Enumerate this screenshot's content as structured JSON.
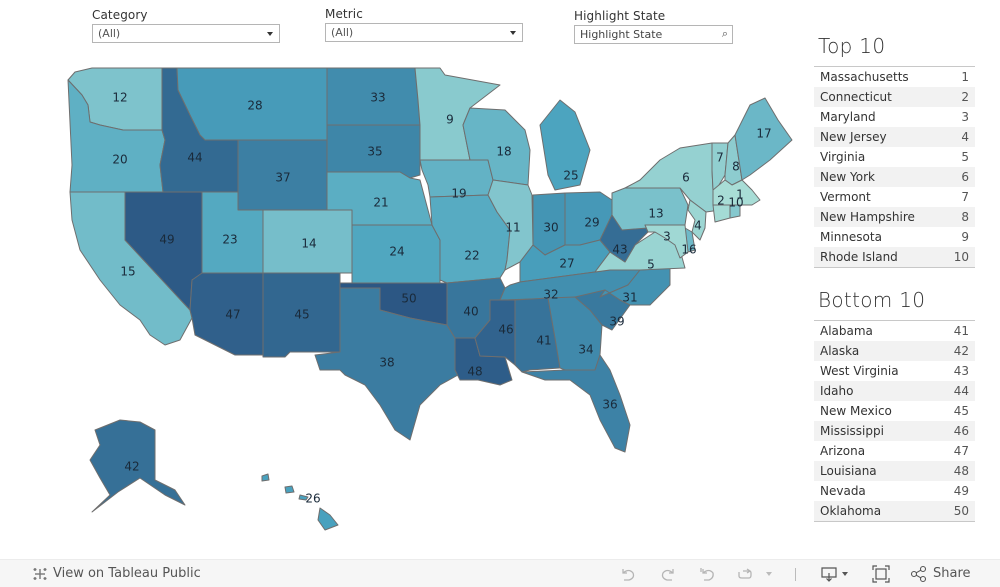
{
  "filters": {
    "category": {
      "label": "Category",
      "value": "(All)"
    },
    "metric": {
      "label": "Metric",
      "value": "(All)"
    },
    "highlight": {
      "label": "Highlight State",
      "placeholder": "Highlight State"
    }
  },
  "colors": {
    "rank_low": "#a8ddd6",
    "rank_mid": "#4aa3bf",
    "rank_high": "#2c5784",
    "state_border": "#6e6e6e",
    "toolbar_bg": "#f6f6f6"
  },
  "map": {
    "states": [
      {
        "abbr": "WA",
        "name": "Washington",
        "rank": 12
      },
      {
        "abbr": "OR",
        "name": "Oregon",
        "rank": 20
      },
      {
        "abbr": "CA",
        "name": "California",
        "rank": 15
      },
      {
        "abbr": "ID",
        "name": "Idaho",
        "rank": 44
      },
      {
        "abbr": "NV",
        "name": "Nevada",
        "rank": 49
      },
      {
        "abbr": "MT",
        "name": "Montana",
        "rank": 28
      },
      {
        "abbr": "WY",
        "name": "Wyoming",
        "rank": 37
      },
      {
        "abbr": "UT",
        "name": "Utah",
        "rank": 23
      },
      {
        "abbr": "CO",
        "name": "Colorado",
        "rank": 14
      },
      {
        "abbr": "AZ",
        "name": "Arizona",
        "rank": 47
      },
      {
        "abbr": "NM",
        "name": "New Mexico",
        "rank": 45
      },
      {
        "abbr": "ND",
        "name": "North Dakota",
        "rank": 33
      },
      {
        "abbr": "SD",
        "name": "South Dakota",
        "rank": 35
      },
      {
        "abbr": "NE",
        "name": "Nebraska",
        "rank": 21
      },
      {
        "abbr": "KS",
        "name": "Kansas",
        "rank": 24
      },
      {
        "abbr": "OK",
        "name": "Oklahoma",
        "rank": 50
      },
      {
        "abbr": "TX",
        "name": "Texas",
        "rank": 38
      },
      {
        "abbr": "MN",
        "name": "Minnesota",
        "rank": 9
      },
      {
        "abbr": "IA",
        "name": "Iowa",
        "rank": 19
      },
      {
        "abbr": "MO",
        "name": "Missouri",
        "rank": 22
      },
      {
        "abbr": "AR",
        "name": "Arkansas",
        "rank": 40
      },
      {
        "abbr": "LA",
        "name": "Louisiana",
        "rank": 48
      },
      {
        "abbr": "WI",
        "name": "Wisconsin",
        "rank": 18
      },
      {
        "abbr": "IL",
        "name": "Illinois",
        "rank": 11
      },
      {
        "abbr": "MI",
        "name": "Michigan",
        "rank": 25
      },
      {
        "abbr": "IN",
        "name": "Indiana",
        "rank": 30
      },
      {
        "abbr": "OH",
        "name": "Ohio",
        "rank": 29
      },
      {
        "abbr": "KY",
        "name": "Kentucky",
        "rank": 27
      },
      {
        "abbr": "TN",
        "name": "Tennessee",
        "rank": 32
      },
      {
        "abbr": "MS",
        "name": "Mississippi",
        "rank": 46
      },
      {
        "abbr": "AL",
        "name": "Alabama",
        "rank": 41
      },
      {
        "abbr": "GA",
        "name": "Georgia",
        "rank": 34
      },
      {
        "abbr": "FL",
        "name": "Florida",
        "rank": 36
      },
      {
        "abbr": "SC",
        "name": "South Carolina",
        "rank": 39
      },
      {
        "abbr": "NC",
        "name": "North Carolina",
        "rank": 31
      },
      {
        "abbr": "VA",
        "name": "Virginia",
        "rank": 5
      },
      {
        "abbr": "WV",
        "name": "West Virginia",
        "rank": 43
      },
      {
        "abbr": "PA",
        "name": "Pennsylvania",
        "rank": 13
      },
      {
        "abbr": "NY",
        "name": "New York",
        "rank": 6
      },
      {
        "abbr": "VT",
        "name": "Vermont",
        "rank": 7
      },
      {
        "abbr": "NH",
        "name": "New Hampshire",
        "rank": 8
      },
      {
        "abbr": "ME",
        "name": "Maine",
        "rank": 17
      },
      {
        "abbr": "MA",
        "name": "Massachusetts",
        "rank": 1
      },
      {
        "abbr": "CT",
        "name": "Connecticut",
        "rank": 2
      },
      {
        "abbr": "RI",
        "name": "Rhode Island",
        "rank": 10
      },
      {
        "abbr": "NJ",
        "name": "New Jersey",
        "rank": 4
      },
      {
        "abbr": "DE",
        "name": "Delaware",
        "rank": 16
      },
      {
        "abbr": "MD",
        "name": "Maryland",
        "rank": 3
      },
      {
        "abbr": "AK",
        "name": "Alaska",
        "rank": 42
      },
      {
        "abbr": "HI",
        "name": "Hawaii",
        "rank": 26
      }
    ]
  },
  "top10": {
    "title": "Top 10",
    "rows": [
      {
        "state": "Massachusetts",
        "rank": "1"
      },
      {
        "state": "Connecticut",
        "rank": "2"
      },
      {
        "state": "Maryland",
        "rank": "3"
      },
      {
        "state": "New Jersey",
        "rank": "4"
      },
      {
        "state": "Virginia",
        "rank": "5"
      },
      {
        "state": "New York",
        "rank": "6"
      },
      {
        "state": "Vermont",
        "rank": "7"
      },
      {
        "state": "New Hampshire",
        "rank": "8"
      },
      {
        "state": "Minnesota",
        "rank": "9"
      },
      {
        "state": "Rhode Island",
        "rank": "10"
      }
    ]
  },
  "bottom10": {
    "title": "Bottom 10",
    "rows": [
      {
        "state": "Alabama",
        "rank": "41"
      },
      {
        "state": "Alaska",
        "rank": "42"
      },
      {
        "state": "West Virginia",
        "rank": "43"
      },
      {
        "state": "Idaho",
        "rank": "44"
      },
      {
        "state": "New Mexico",
        "rank": "45"
      },
      {
        "state": "Mississippi",
        "rank": "46"
      },
      {
        "state": "Arizona",
        "rank": "47"
      },
      {
        "state": "Louisiana",
        "rank": "48"
      },
      {
        "state": "Nevada",
        "rank": "49"
      },
      {
        "state": "Oklahoma",
        "rank": "50"
      }
    ]
  },
  "toolbar": {
    "view_public": "View on Tableau Public",
    "share": "Share",
    "icons": [
      "undo-icon",
      "redo-icon",
      "revert-icon",
      "refresh-icon",
      "download-icon",
      "fullscreen-icon",
      "share-icon"
    ]
  }
}
